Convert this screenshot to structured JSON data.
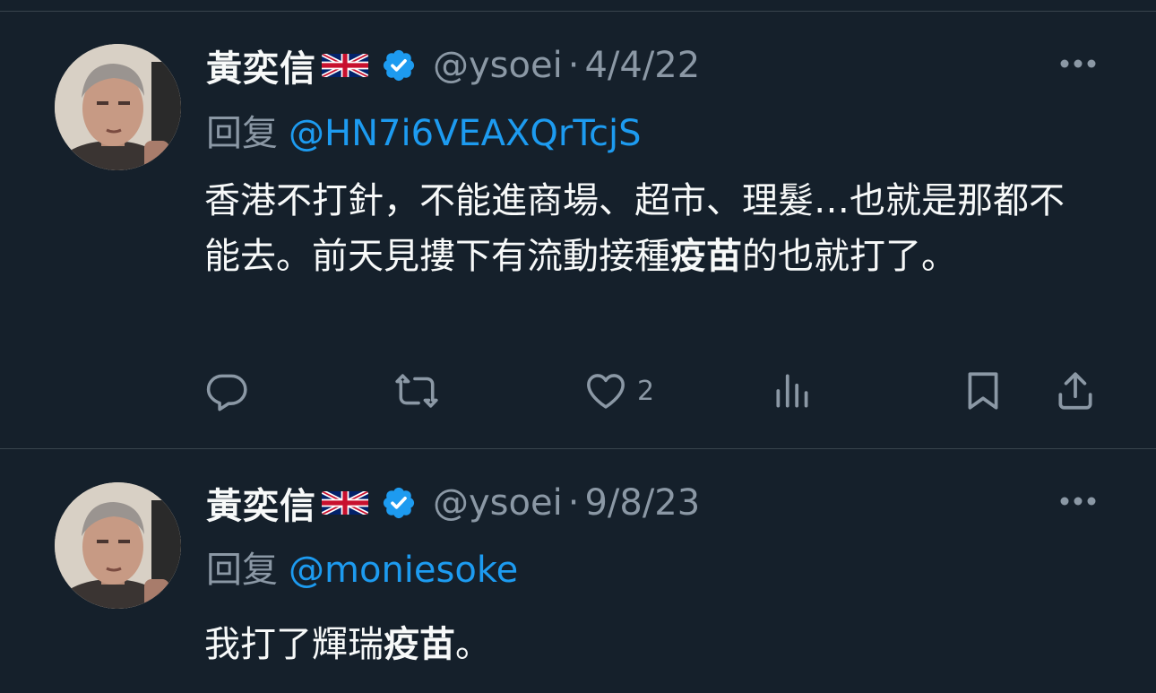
{
  "tweets": [
    {
      "author_name": "黃奕信",
      "flag_icon": "uk-flag-icon",
      "verified_icon": "verified-badge-icon",
      "handle": "@ysoei",
      "separator": "·",
      "date": "4/4/22",
      "reply_prefix": "回复",
      "reply_to": "@HN7i6VEAXQrTcjS",
      "text_parts": [
        "香港不打針，不能進商場、超市、理髮…也就是那都不能去。前天見摟下有流動接種",
        "疫苗",
        "的也就打了。"
      ],
      "likes": "2"
    },
    {
      "author_name": "黃奕信",
      "flag_icon": "uk-flag-icon",
      "verified_icon": "verified-badge-icon",
      "handle": "@ysoei",
      "separator": "·",
      "date": "9/8/23",
      "reply_prefix": "回复",
      "reply_to": "@moniesoke",
      "text_parts": [
        "我打了輝瑞",
        "疫苗",
        "。"
      ]
    }
  ],
  "colors": {
    "background": "#15202b",
    "text": "#f7f9f9",
    "muted": "#8b98a5",
    "link": "#1d9bf0",
    "divider": "#38444d"
  }
}
